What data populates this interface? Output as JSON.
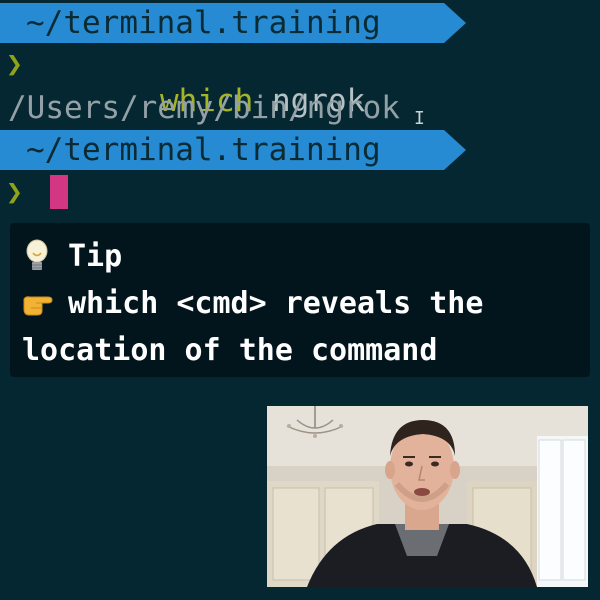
{
  "terminal": {
    "banner_1": "~/terminal.training",
    "prompt_symbol": "❯",
    "command_name": "which",
    "command_arg": "ngrok",
    "output": "/Users/remy/bin/ngrok",
    "banner_2": "~/terminal.training",
    "prompt_symbol_2": "❯"
  },
  "tip": {
    "title": "Tip",
    "line_1": "which <cmd> reveals the",
    "line_2": "location of the command",
    "title_icon": "lightbulb-icon",
    "pointer_icon": "pointing-hand-icon"
  },
  "colors": {
    "background": "#052732",
    "banner": "#268bd2",
    "prompt": "#8fa318",
    "cursor": "#d33682",
    "tip_bg": "#02151c"
  }
}
